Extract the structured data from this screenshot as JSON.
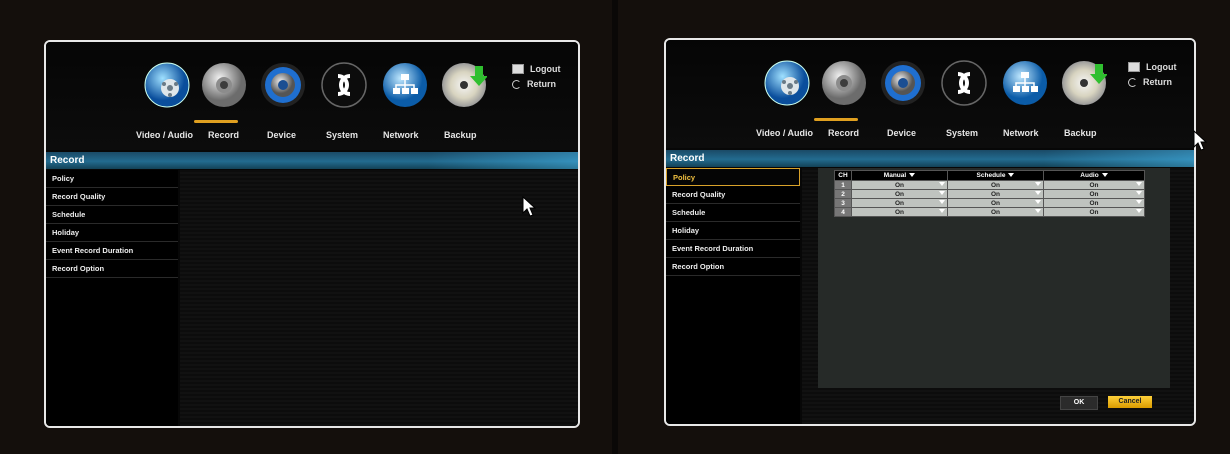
{
  "nav": {
    "items": [
      {
        "label": "Video / Audio",
        "icon": "video-audio-icon"
      },
      {
        "label": "Record",
        "icon": "record-icon"
      },
      {
        "label": "Device",
        "icon": "device-icon"
      },
      {
        "label": "System",
        "icon": "system-icon"
      },
      {
        "label": "Network",
        "icon": "network-icon"
      },
      {
        "label": "Backup",
        "icon": "backup-icon"
      }
    ],
    "active": "Record",
    "logout": "Logout",
    "return": "Return"
  },
  "menu": {
    "title": "Record"
  },
  "sidebar": {
    "items": [
      {
        "label": "Policy"
      },
      {
        "label": "Record Quality"
      },
      {
        "label": "Schedule"
      },
      {
        "label": "Holiday"
      },
      {
        "label": "Event Record Duration"
      },
      {
        "label": "Record Option"
      }
    ]
  },
  "policy_table": {
    "headers": [
      "CH",
      "Manual",
      "Schedule",
      "Audio"
    ],
    "rows": [
      {
        "ch": "1",
        "manual": "On",
        "schedule": "On",
        "audio": "On"
      },
      {
        "ch": "2",
        "manual": "On",
        "schedule": "On",
        "audio": "On"
      },
      {
        "ch": "3",
        "manual": "On",
        "schedule": "On",
        "audio": "On"
      },
      {
        "ch": "4",
        "manual": "On",
        "schedule": "On",
        "audio": "On"
      }
    ]
  },
  "buttons": {
    "ok": "OK",
    "cancel": "Cancel"
  },
  "colors": {
    "accent": "#236b8f",
    "highlight": "#e0a020",
    "cancel": "#f5b800"
  }
}
